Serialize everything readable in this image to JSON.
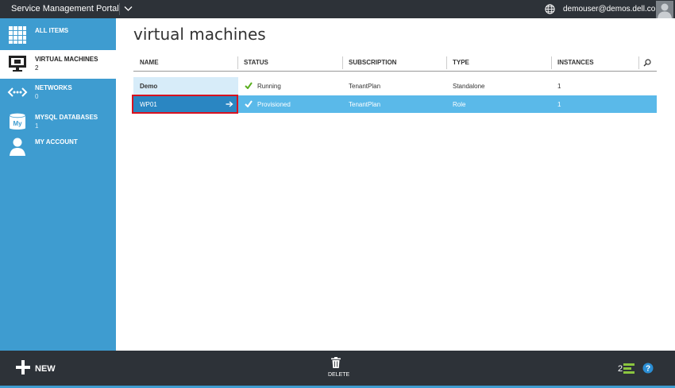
{
  "topbar": {
    "title": "Service Management Portal",
    "user": "demouser@demos.dell.com"
  },
  "sidebar": {
    "items": [
      {
        "label": "ALL ITEMS",
        "count": ""
      },
      {
        "label": "VIRTUAL MACHINES",
        "count": "2"
      },
      {
        "label": "NETWORKS",
        "count": "0"
      },
      {
        "label": "MYSQL DATABASES",
        "count": "1"
      },
      {
        "label": "MY ACCOUNT",
        "count": ""
      }
    ]
  },
  "main": {
    "title": "virtual machines",
    "columns": [
      "NAME",
      "STATUS",
      "SUBSCRIPTION",
      "TYPE",
      "INSTANCES"
    ],
    "rows": [
      {
        "name": "Demo",
        "status": "Running",
        "subscription": "TenantPlan",
        "type": "Standalone",
        "instances": "1"
      },
      {
        "name": "WP01",
        "status": "Provisioned",
        "subscription": "TenantPlan",
        "type": "Role",
        "instances": "1"
      }
    ]
  },
  "bottombar": {
    "new_label": "NEW",
    "delete_label": "DELETE",
    "notifications_count": "2"
  },
  "colors": {
    "accent": "#3e9cd0",
    "dark": "#2d3238",
    "selected_row": "#5ab9e9",
    "highlight": "#d8121f"
  }
}
